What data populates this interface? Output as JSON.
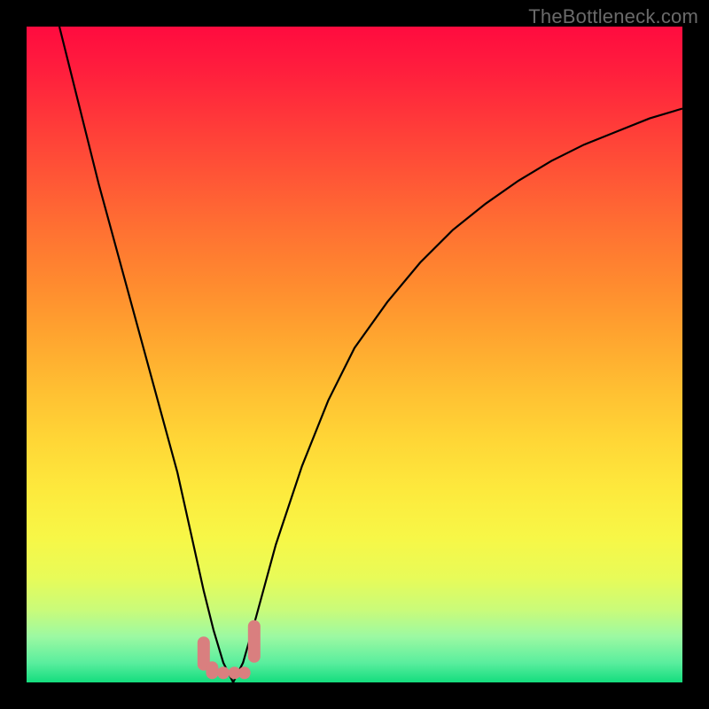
{
  "watermark": "TheBottleneck.com",
  "chart_data": {
    "type": "line",
    "title": "",
    "xlabel": "",
    "ylabel": "",
    "xlim": [
      0,
      100
    ],
    "ylim": [
      0,
      100
    ],
    "series": [
      {
        "name": "bottleneck-curve",
        "x": [
          5,
          8,
          11,
          14,
          17,
          20,
          23,
          25,
          27,
          28.5,
          30,
          31.5,
          33,
          35,
          38,
          42,
          46,
          50,
          55,
          60,
          65,
          70,
          75,
          80,
          85,
          90,
          95,
          100
        ],
        "y": [
          100,
          88,
          76,
          65,
          54,
          43,
          32,
          23,
          14,
          8,
          3,
          0,
          3,
          10,
          21,
          33,
          43,
          51,
          58,
          64,
          69,
          73,
          76.5,
          79.5,
          82,
          84,
          86,
          87.5
        ]
      }
    ],
    "markers": [
      {
        "name": "pink-marker",
        "x": 27.0,
        "y_top": 7.0,
        "y_bot": 1.8
      },
      {
        "name": "pink-marker",
        "x": 28.3,
        "y_top": 3.2,
        "y_bot": 0.5
      },
      {
        "name": "pink-marker",
        "x": 30.0,
        "y_top": 2.4,
        "y_bot": 0.5
      },
      {
        "name": "pink-marker",
        "x": 31.7,
        "y_top": 2.4,
        "y_bot": 0.5
      },
      {
        "name": "pink-marker",
        "x": 33.2,
        "y_top": 2.4,
        "y_bot": 0.5
      },
      {
        "name": "pink-marker",
        "x": 34.7,
        "y_top": 9.5,
        "y_bot": 3.0
      }
    ],
    "marker_color": "#d97f7f",
    "curve_color": "#000000"
  }
}
